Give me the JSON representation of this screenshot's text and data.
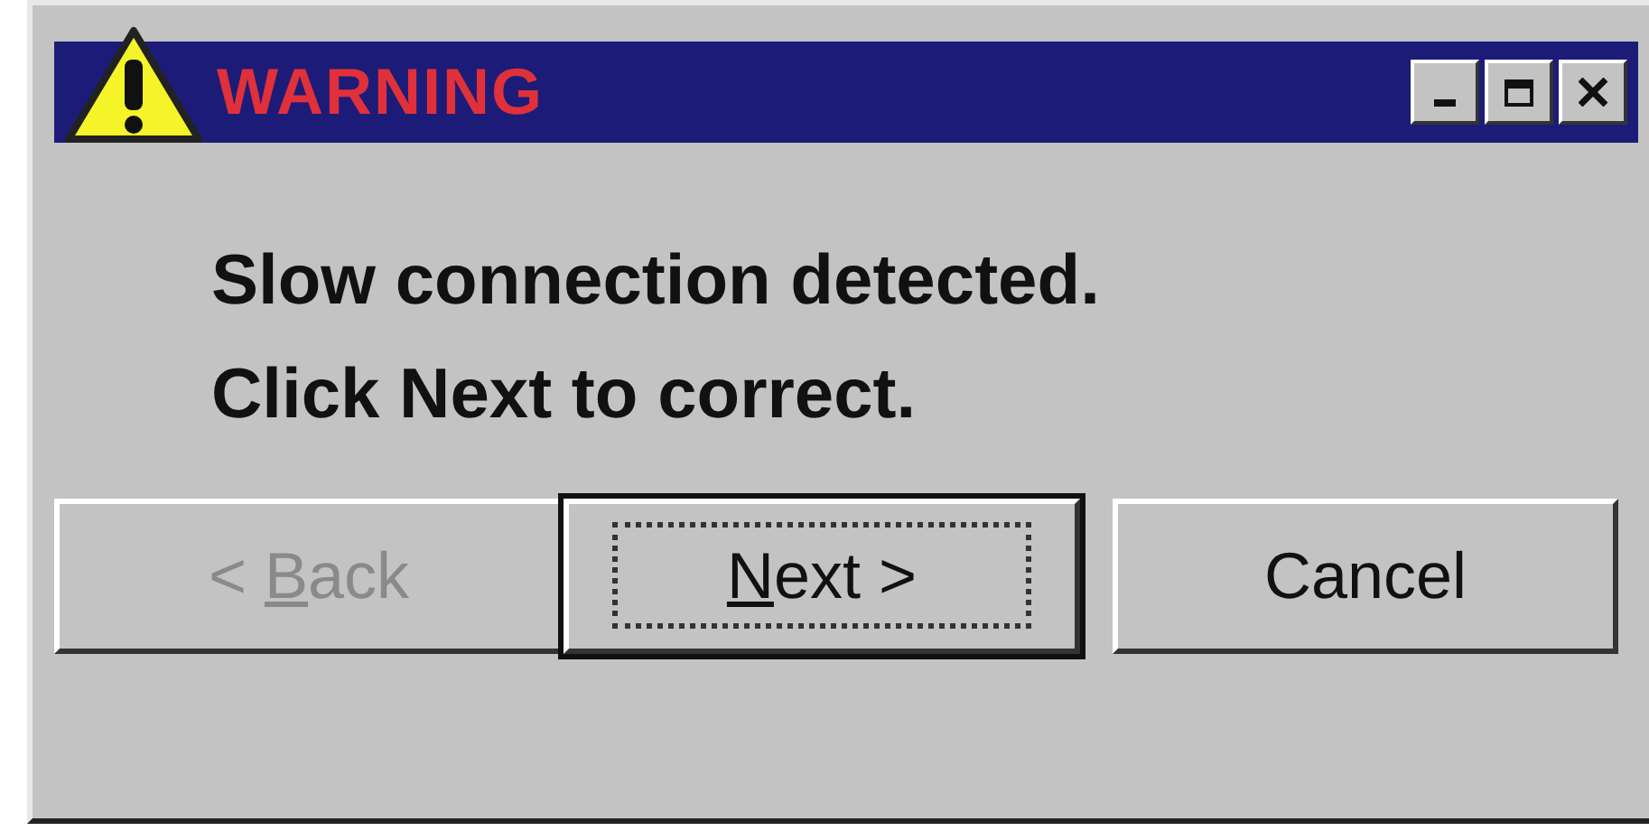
{
  "window": {
    "title": "WARNING",
    "controls": [
      {
        "kind": "minimize"
      },
      {
        "kind": "maximize"
      },
      {
        "kind": "close"
      }
    ]
  },
  "message": [
    "Slow connection detected.",
    "Click Next to correct."
  ],
  "buttons": [
    {
      "before": "< ",
      "key": "B",
      "after": "ack",
      "disabled": true,
      "focused": false
    },
    {
      "key": "N",
      "after": "ext >",
      "disabled": false,
      "focused": true
    },
    {
      "before": "Cancel",
      "disabled": false,
      "focused": false
    }
  ]
}
